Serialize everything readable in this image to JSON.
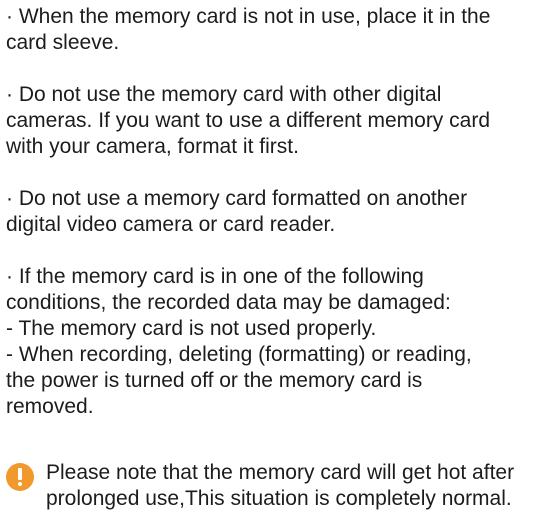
{
  "paragraphs": [
    {
      "lines": [
        "·  When the memory card is not in use, place it in the",
        "card sleeve."
      ]
    },
    {
      "lines": [
        "·  Do not use the memory card with other digital",
        "cameras. If you want to use a different memory card",
        "with your camera, format it first."
      ]
    },
    {
      "lines": [
        "·  Do not use a memory card formatted on another",
        "digital video camera or card reader."
      ]
    },
    {
      "lines": [
        "·  If the memory card is in one of the following",
        "conditions, the recorded data may be damaged:",
        "- The memory card is not used properly.",
        "- When recording, deleting (formatting) or reading,",
        "the power is turned off or the memory card is",
        "removed."
      ]
    }
  ],
  "note": {
    "icon": "warning-exclamation-icon",
    "icon_color": "#f2992e",
    "lines": [
      "Please note that the memory card will get hot after",
      "prolonged use,This situation is completely normal."
    ]
  }
}
